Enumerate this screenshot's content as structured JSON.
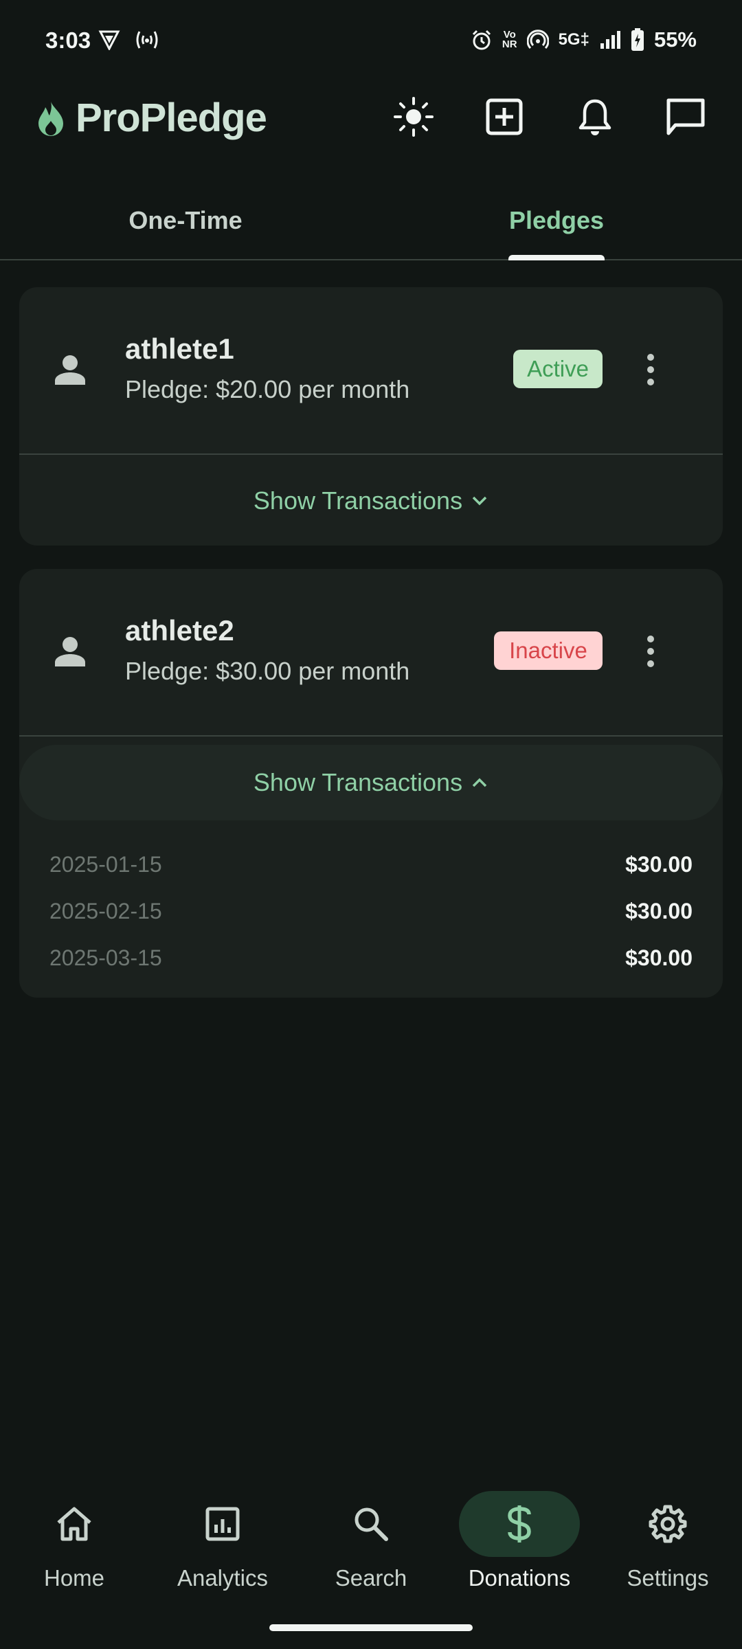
{
  "status_bar": {
    "time": "3:03",
    "network": "5G‡",
    "battery": "55%",
    "vonr_line1": "Vo",
    "vonr_line2": "NR"
  },
  "app": {
    "title": "ProPledge",
    "accent_color": "#8fd0a6",
    "actions": [
      "theme-toggle-icon",
      "add-icon",
      "notifications-icon",
      "messages-icon"
    ]
  },
  "tabs": [
    {
      "label": "One-Time",
      "selected": false
    },
    {
      "label": "Pledges",
      "selected": true
    }
  ],
  "pledges": [
    {
      "name": "athlete1",
      "pledge": "Pledge: $20.00 per month",
      "status": "Active",
      "toggle_label": "Show Transactions",
      "expanded": false,
      "transactions": []
    },
    {
      "name": "athlete2",
      "pledge": "Pledge: $30.00 per month",
      "status": "Inactive",
      "toggle_label": "Show Transactions",
      "expanded": true,
      "transactions": [
        {
          "date": "2025-01-15",
          "amount": "$30.00"
        },
        {
          "date": "2025-02-15",
          "amount": "$30.00"
        },
        {
          "date": "2025-03-15",
          "amount": "$30.00"
        }
      ]
    }
  ],
  "bottom_nav": [
    {
      "label": "Home",
      "icon": "home-icon",
      "active": false
    },
    {
      "label": "Analytics",
      "icon": "analytics-icon",
      "active": false
    },
    {
      "label": "Search",
      "icon": "search-icon",
      "active": false
    },
    {
      "label": "Donations",
      "icon": "dollar-icon",
      "active": true
    },
    {
      "label": "Settings",
      "icon": "gear-icon",
      "active": false
    }
  ]
}
